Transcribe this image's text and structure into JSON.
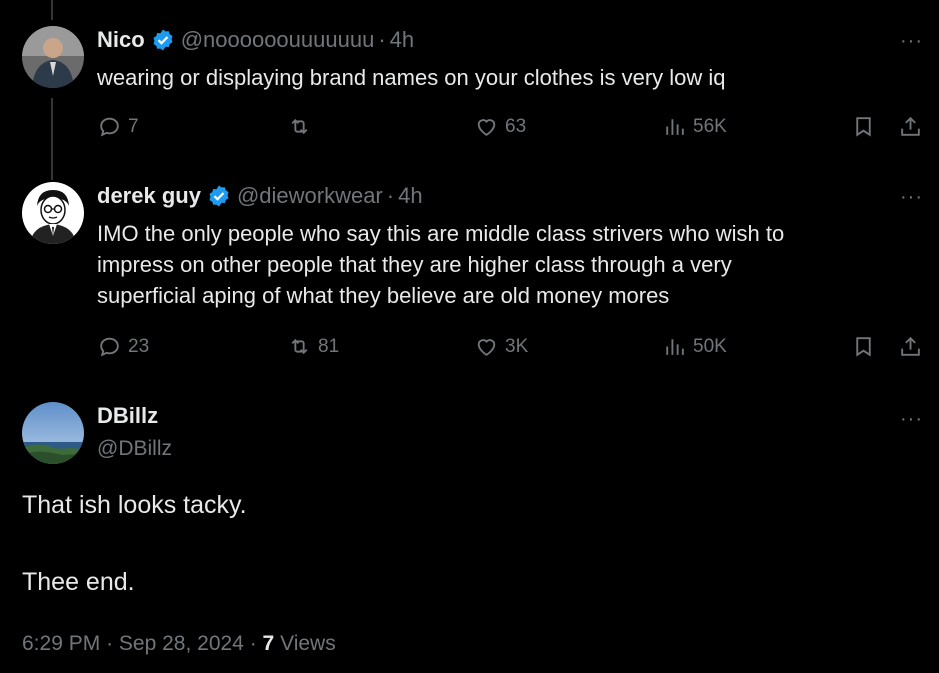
{
  "tweets": [
    {
      "name": "Nico",
      "handle": "@noooooouuuuuuu",
      "age": "4h",
      "text": "wearing or displaying brand names on your clothes is very low iq",
      "replies": "7",
      "reposts": "",
      "likes": "63",
      "views": "56K"
    },
    {
      "name": "derek guy",
      "handle": "@dieworkwear",
      "age": "4h",
      "text_lines": [
        "IMO the only people who say this are middle class strivers who wish to",
        "impress on other people that they are higher class through a very",
        "superficial aping of what they believe are old money mores"
      ],
      "replies": "23",
      "reposts": "81",
      "likes": "3K",
      "views": "50K"
    }
  ],
  "focus": {
    "name": "DBillz",
    "handle": "@DBillz",
    "line1": "That ish looks tacky.",
    "line2": "Thee end.",
    "time": "6:29 PM",
    "date": "Sep 28, 2024",
    "views_count": "7",
    "views_label": "Views"
  },
  "separator": "·",
  "more_glyph": "···",
  "colors": {
    "verified": "#1d9bf0",
    "muted": "#71767b",
    "text": "#e7e9ea",
    "background": "#000000"
  }
}
